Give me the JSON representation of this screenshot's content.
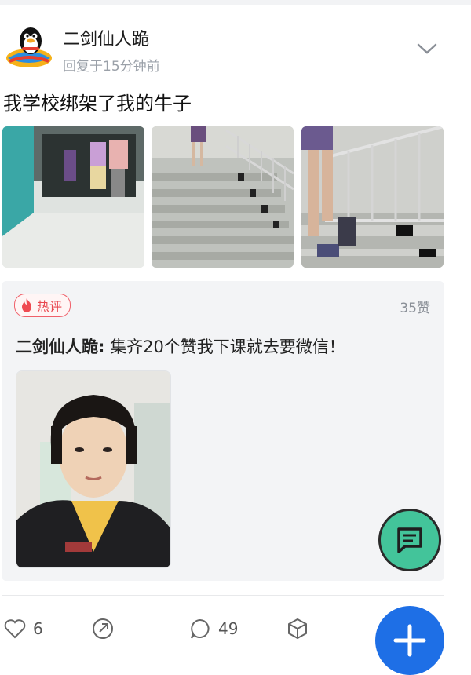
{
  "post": {
    "author": "二剑仙人跪",
    "timestamp": "回复于15分钟前",
    "text": "我学校绑架了我的牛子",
    "images": [
      {
        "icon": "photo-hallway"
      },
      {
        "icon": "photo-stairs"
      },
      {
        "icon": "photo-stairs-closeup"
      }
    ]
  },
  "hot_comment": {
    "badge": "热评",
    "likes": "35赞",
    "author": "二剑仙人跪:",
    "text": " 集齐20个赞我下课就去要微信！"
  },
  "actions": {
    "like_count": "6",
    "comment_count": "49"
  },
  "colors": {
    "accent_blue": "#1e6fe6",
    "chat_green": "#43c49a",
    "hot_red": "#e8474f"
  }
}
